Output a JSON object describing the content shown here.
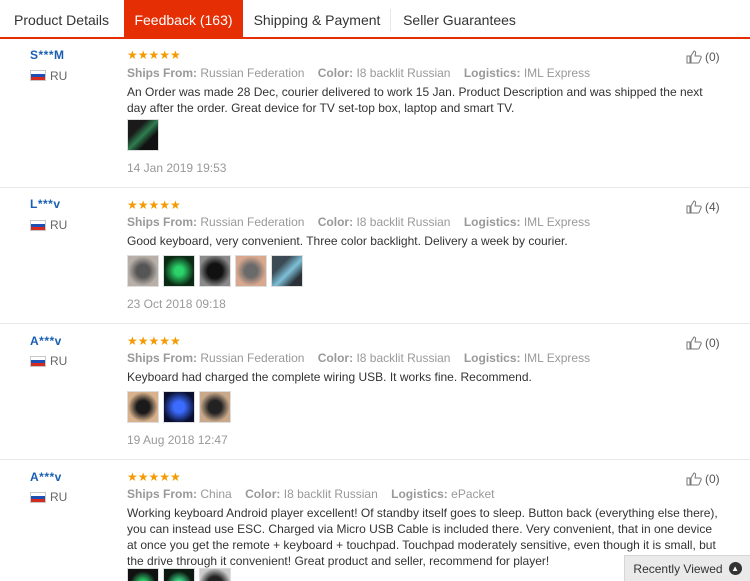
{
  "tabs": [
    {
      "label": "Product Details"
    },
    {
      "label": "Feedback (163)"
    },
    {
      "label": "Shipping & Payment"
    },
    {
      "label": "Seller Guarantees"
    }
  ],
  "labels": {
    "ships_from": "Ships From:",
    "color": "Color:",
    "logistics": "Logistics:",
    "stars": "★★★★★"
  },
  "reviews": [
    {
      "user": "S***M",
      "country": "RU",
      "ships_from": "Russian Federation",
      "color": "I8 backlit Russian",
      "logistics": "IML Express",
      "text": "An Order was made 28 Dec, courier delivered to work 15 Jan. Product Description and was shipped the next day after the order. Great device for TV set-top box, laptop and smart TV.",
      "date": "14 Jan 2019 19:53",
      "helpful": "(0)"
    },
    {
      "user": "L***v",
      "country": "RU",
      "ships_from": "Russian Federation",
      "color": "I8 backlit Russian",
      "logistics": "IML Express",
      "text": "Good keyboard, very convenient. Three color backlight. Delivery a week by courier.",
      "date": "23 Oct 2018 09:18",
      "helpful": "(4)"
    },
    {
      "user": "A***v",
      "country": "RU",
      "ships_from": "Russian Federation",
      "color": "I8 backlit Russian",
      "logistics": "IML Express",
      "text": "Keyboard had charged the complete wiring USB. It works fine. Recommend.",
      "date": "19 Aug 2018 12:47",
      "helpful": "(0)"
    },
    {
      "user": "A***v",
      "country": "RU",
      "ships_from": "China",
      "color": "I8 backlit Russian",
      "logistics": "ePacket",
      "text": "Working keyboard Android player excellent! Of standby itself goes to sleep. Button back (everything else there), you can instead use ESC. Charged via Micro USB Cable is included there. Very convenient, that in one device at once you get the remote + keyboard + touchpad. Touchpad moderately sensitive, even though it is small, but the drive through it convenient! Great product and seller, recommend for player!",
      "helpful": "(0)"
    }
  ],
  "recently_viewed": {
    "label": "Recently Viewed",
    "icon": "chevron-up-icon"
  },
  "colors": {
    "accent": "#e62e04",
    "link": "#1a5fb4",
    "star": "#f59a00"
  }
}
